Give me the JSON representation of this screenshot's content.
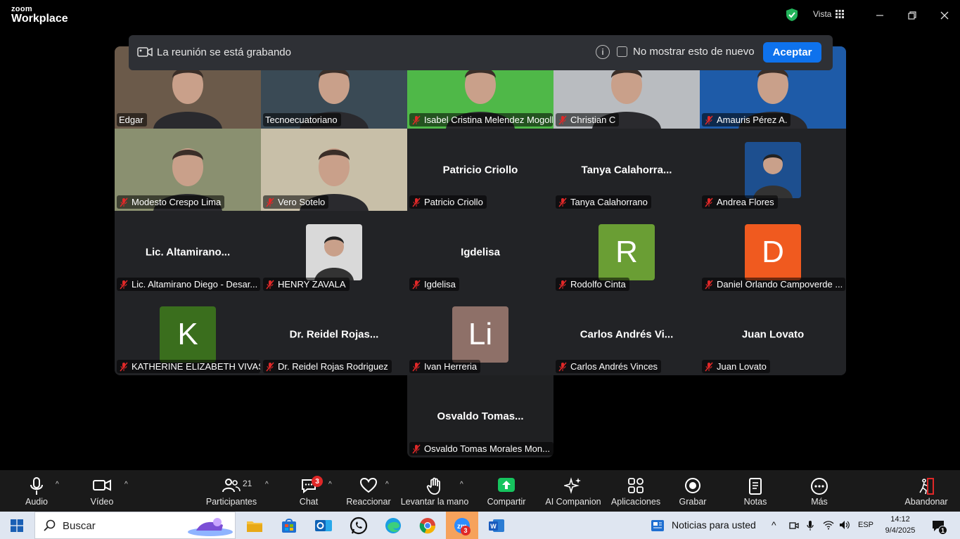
{
  "app": {
    "brand_small": "zoom",
    "brand_main": "Workplace",
    "view_label": "Vista"
  },
  "banner": {
    "text": "La reunión se está grabando",
    "checkbox_label": "No mostrar esto de nuevo",
    "accept_label": "Aceptar"
  },
  "participants": [
    {
      "name": "Edgar",
      "muted": false,
      "display": "video",
      "bg": "#6b5a4a"
    },
    {
      "name": "Tecnoecuatoriano",
      "muted": false,
      "display": "video",
      "bg": "#3a4a55",
      "active": true
    },
    {
      "name": "Isabel Cristina Melendez Mogoll...",
      "muted": true,
      "display": "video",
      "bg": "#4fb848"
    },
    {
      "name": "Christian C",
      "muted": true,
      "display": "video",
      "bg": "#b9bcc0"
    },
    {
      "name": "Amauris Pérez A.",
      "muted": true,
      "display": "video",
      "bg": "#1e5ba8"
    },
    {
      "name": "Modesto Crespo Lima",
      "muted": true,
      "display": "video",
      "bg": "#8a9070"
    },
    {
      "name": "Vero Sotelo",
      "muted": true,
      "display": "video",
      "bg": "#c8bfa8"
    },
    {
      "name": "Patricio Criollo",
      "muted": true,
      "display": "name",
      "center": "Patricio Criollo"
    },
    {
      "name": "Tanya Calahorrano",
      "muted": true,
      "display": "name",
      "center": "Tanya  Calahorra..."
    },
    {
      "name": "Andrea Flores",
      "muted": true,
      "display": "photo",
      "bg": "#1d4f8f"
    },
    {
      "name": "Lic. Altamirano Diego - Desar...",
      "muted": true,
      "display": "name",
      "center": "Lic.  Altamirano..."
    },
    {
      "name": "HENRY ZAVALA",
      "muted": true,
      "display": "photo",
      "bg": "#d9d9d9"
    },
    {
      "name": "Igdelisa",
      "muted": true,
      "display": "name",
      "center": "Igdelisa"
    },
    {
      "name": "Rodolfo Cinta",
      "muted": true,
      "display": "avatar",
      "initials": "R",
      "bg": "#6a9e34"
    },
    {
      "name": "Daniel Orlando Campoverde ...",
      "muted": true,
      "display": "avatar",
      "initials": "D",
      "bg": "#f05a1f"
    },
    {
      "name": "KATHERINE ELIZABETH VIVAS ...",
      "muted": true,
      "display": "avatar",
      "initials": "K",
      "bg": "#3a6e1d"
    },
    {
      "name": "Dr. Reidel Rojas Rodriguez",
      "muted": true,
      "display": "name",
      "center": "Dr.  Reidel Rojas..."
    },
    {
      "name": "Ivan Herreria",
      "muted": true,
      "display": "avatar",
      "initials": "Li",
      "bg": "#8e7068"
    },
    {
      "name": "Carlos Andrés Vinces",
      "muted": true,
      "display": "name",
      "center": "Carlos  Andrés Vi..."
    },
    {
      "name": "Juan Lovato",
      "muted": true,
      "display": "name",
      "center": "Juan Lovato"
    }
  ],
  "extra_participant": {
    "name": "Osvaldo Tomas Morales Mon...",
    "center": "Osvaldo  Tomas..."
  },
  "toolbar": {
    "audio": "Audio",
    "video": "Vídeo",
    "participants": "Participantes",
    "participants_count": "21",
    "chat": "Chat",
    "chat_badge": "3",
    "react": "Reaccionar",
    "raise_hand": "Levantar la mano",
    "share": "Compartir",
    "ai": "AI Companion",
    "apps": "Aplicaciones",
    "record": "Grabar",
    "notes": "Notas",
    "more": "Más",
    "leave": "Abandonar"
  },
  "taskbar": {
    "search": "Buscar",
    "news": "Noticias para usted",
    "lang": "ESP",
    "time": "14:12",
    "date": "9/4/2025",
    "zoom_badge": "3",
    "notif_badge": "1"
  },
  "colors": {
    "accent": "#0e72ed",
    "active_speaker": "#36c46b",
    "muted_red": "#e02828",
    "share_green": "#16c45e"
  }
}
